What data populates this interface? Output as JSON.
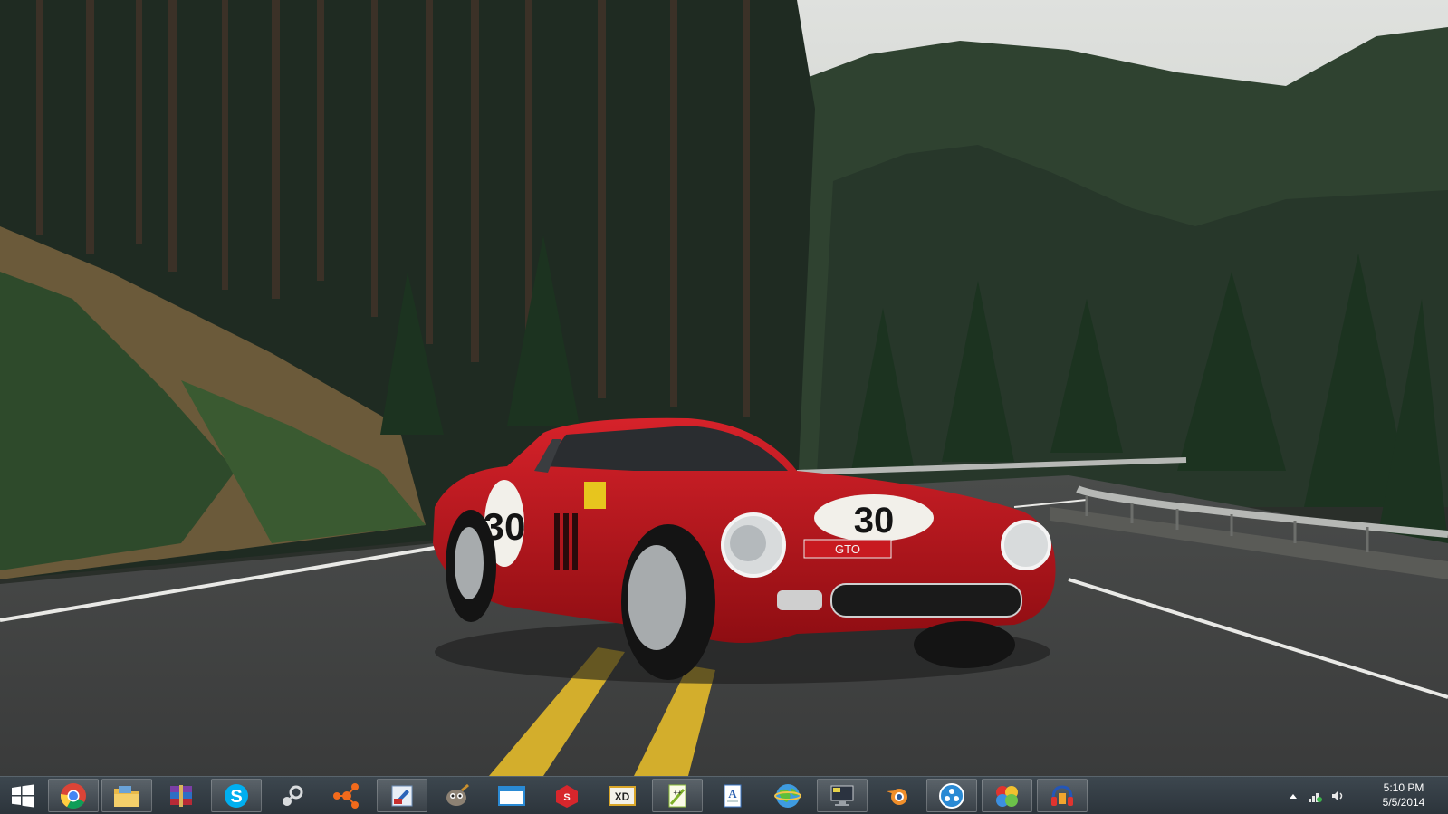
{
  "desktop": {
    "wallpaper": "red classic race car with number 30 on a forest road"
  },
  "car": {
    "race_number": "30",
    "plate_text": "GTO"
  },
  "taskbar": {
    "start_icon": "windows-logo-icon",
    "items": [
      {
        "name": "chrome",
        "icon": "chrome-icon",
        "pinned": true
      },
      {
        "name": "file-explorer",
        "icon": "folder-icon",
        "pinned": true
      },
      {
        "name": "winrar",
        "icon": "winrar-icon",
        "pinned": false
      },
      {
        "name": "skype",
        "icon": "skype-icon",
        "pinned": true
      },
      {
        "name": "steam",
        "icon": "steam-icon",
        "pinned": false
      },
      {
        "name": "network-app",
        "icon": "nodes-icon",
        "pinned": false
      },
      {
        "name": "image-editor",
        "icon": "paint-icon",
        "pinned": true
      },
      {
        "name": "gimp",
        "icon": "gimp-icon",
        "pinned": false
      },
      {
        "name": "window-app",
        "icon": "window-icon",
        "pinned": false
      },
      {
        "name": "sketchup",
        "icon": "sketchup-icon",
        "pinned": false
      },
      {
        "name": "xd-app",
        "icon": "xd-icon",
        "pinned": false
      },
      {
        "name": "notepad-plus-plus",
        "icon": "notepadpp-icon",
        "pinned": true
      },
      {
        "name": "text-document",
        "icon": "document-icon",
        "pinned": false
      },
      {
        "name": "globe-app",
        "icon": "globe-icon",
        "pinned": false
      },
      {
        "name": "computer-app",
        "icon": "computer-icon",
        "pinned": true
      },
      {
        "name": "blender",
        "icon": "blender-icon",
        "pinned": false
      },
      {
        "name": "media-app",
        "icon": "media-circle-icon",
        "pinned": true
      },
      {
        "name": "color-app",
        "icon": "color-balls-icon",
        "pinned": true
      },
      {
        "name": "audacity",
        "icon": "headphones-icon",
        "pinned": true
      }
    ],
    "tray": {
      "icons": [
        "show-hidden-icons-icon",
        "network-icon",
        "volume-icon"
      ],
      "time": "5:10 PM",
      "date": "5/5/2014"
    }
  },
  "colors": {
    "car_red": "#b8141a",
    "taskbar": "#2c343b",
    "accent_blue": "#2a8ad4"
  }
}
